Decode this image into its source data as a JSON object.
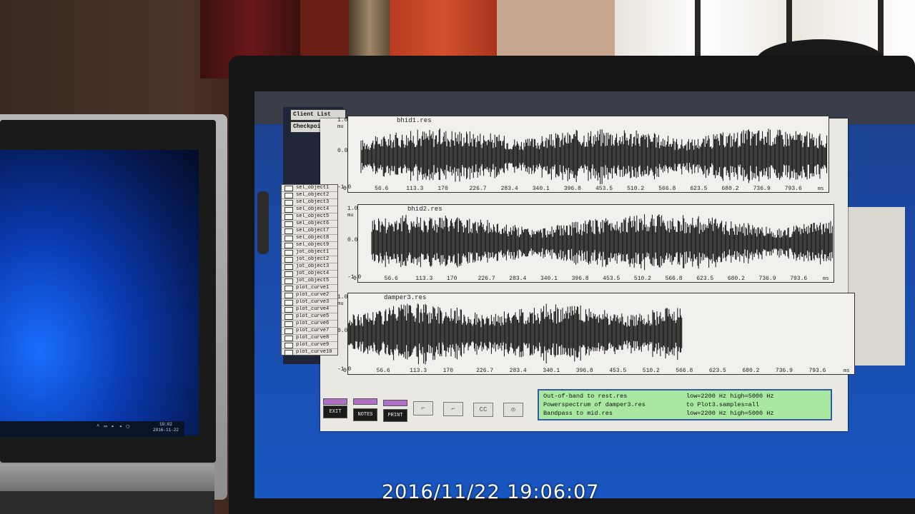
{
  "camera": {
    "timestamp": "2016/11/22 19:06:07"
  },
  "left_laptop": {
    "clock": "19:02",
    "date": "2016-11-22"
  },
  "app": {
    "buttons": {
      "client_list": "Client List",
      "checkpoint": "Checkpoint"
    },
    "object_list": [
      "sel_object1",
      "sel_object2",
      "sel_object3",
      "sel_object4",
      "sel_object5",
      "sel_object6",
      "sel_object7",
      "sel_object8",
      "sel_object9",
      "jot_object1",
      "jot_object2",
      "jot_object3",
      "jot_object4",
      "jot_object5",
      "plot_curve1",
      "plot_curve2",
      "plot_curve3",
      "plot_curve4",
      "plot_curve5",
      "plot_curve6",
      "plot_curve7",
      "plot_curve8",
      "plot_curve9",
      "plot_curve10"
    ],
    "plots": [
      {
        "title": "bhid1.res",
        "ymax": "1.0",
        "ymid": "0.0",
        "ymin": "-1.0",
        "yunit": "mu"
      },
      {
        "title": "bhid2.res",
        "ymax": "1.0",
        "ymid": "0.0",
        "ymin": "-1.0",
        "yunit": "mu"
      },
      {
        "title": "damper3.res",
        "ymax": "1.0",
        "ymid": "0.0",
        "ymin": "-1.0",
        "yunit": "mu"
      }
    ],
    "x_ticks": [
      "0",
      "56.6",
      "113.3",
      "170",
      "226.7",
      "283.4",
      "340.1",
      "396.8",
      "453.5",
      "510.2",
      "566.8",
      "623.5",
      "680.2",
      "736.9",
      "793.6"
    ],
    "x_unit": "ms",
    "toolbar": {
      "exit": "EXIT",
      "notes": "NOTES",
      "print": "PRINT"
    },
    "status": [
      {
        "left": "Out-of-band to rest.res",
        "right": "low=2200 Hz high=5000 Hz"
      },
      {
        "left": "Powerspectrum of damper3.res",
        "right": "to Plot3.samples=all"
      },
      {
        "left": "Bandpass to mid.res",
        "right": "low=2200 Hz high=5000 Hz"
      }
    ]
  }
}
